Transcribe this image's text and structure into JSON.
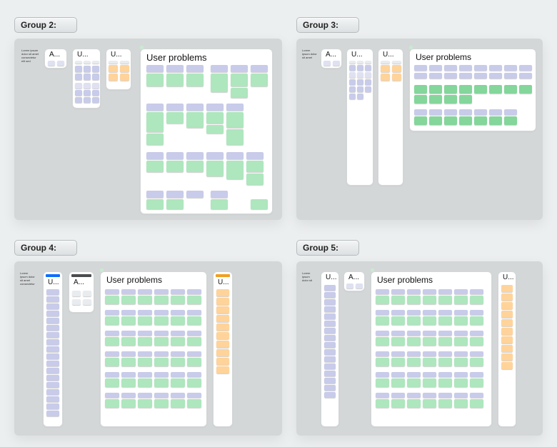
{
  "groups": {
    "g2": {
      "label": "Group 2:"
    },
    "g3": {
      "label": "Group 3:"
    },
    "g4": {
      "label": "Group 4:"
    },
    "g5": {
      "label": "Group 5:"
    }
  },
  "titles": {
    "a_trunc": "A...",
    "u_trunc": "U...",
    "user_problems": "User problems"
  }
}
